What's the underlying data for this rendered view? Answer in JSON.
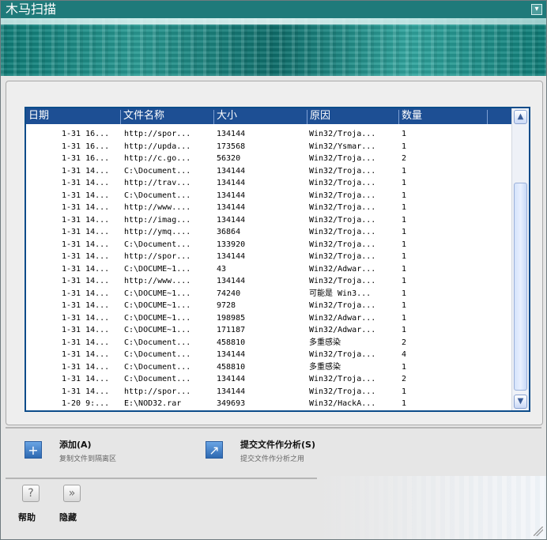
{
  "window": {
    "title": "木马扫描",
    "collapse_icon": "collapse-icon"
  },
  "table": {
    "headers": [
      "日期",
      "文件名称",
      "大小",
      "原因",
      "数量"
    ],
    "rows": [
      {
        "date": "1-31 16...",
        "name": "http://spor...",
        "size": "134144",
        "reason": "Win32/Troja...",
        "count": "1"
      },
      {
        "date": "1-31 16...",
        "name": "http://upda...",
        "size": "173568",
        "reason": "Win32/Ysmar...",
        "count": "1"
      },
      {
        "date": "1-31 16...",
        "name": "http://c.go...",
        "size": "56320",
        "reason": "Win32/Troja...",
        "count": "2"
      },
      {
        "date": "1-31 14...",
        "name": "C:\\Document...",
        "size": "134144",
        "reason": "Win32/Troja...",
        "count": "1"
      },
      {
        "date": "1-31 14...",
        "name": "http://trav...",
        "size": "134144",
        "reason": "Win32/Troja...",
        "count": "1"
      },
      {
        "date": "1-31 14...",
        "name": "C:\\Document...",
        "size": "134144",
        "reason": "Win32/Troja...",
        "count": "1"
      },
      {
        "date": "1-31 14...",
        "name": "http://www....",
        "size": "134144",
        "reason": "Win32/Troja...",
        "count": "1"
      },
      {
        "date": "1-31 14...",
        "name": "http://imag...",
        "size": "134144",
        "reason": "Win32/Troja...",
        "count": "1"
      },
      {
        "date": "1-31 14...",
        "name": "http://ymq....",
        "size": "36864",
        "reason": "Win32/Troja...",
        "count": "1"
      },
      {
        "date": "1-31 14...",
        "name": "C:\\Document...",
        "size": "133920",
        "reason": "Win32/Troja...",
        "count": "1"
      },
      {
        "date": "1-31 14...",
        "name": "http://spor...",
        "size": "134144",
        "reason": "Win32/Troja...",
        "count": "1"
      },
      {
        "date": "1-31 14...",
        "name": "C:\\DOCUME~1...",
        "size": "43",
        "reason": "Win32/Adwar...",
        "count": "1"
      },
      {
        "date": "1-31 14...",
        "name": "http://www....",
        "size": "134144",
        "reason": "Win32/Troja...",
        "count": "1"
      },
      {
        "date": "1-31 14...",
        "name": "C:\\DOCUME~1...",
        "size": "74240",
        "reason": "可能是 Win3...",
        "count": "1"
      },
      {
        "date": "1-31 14...",
        "name": "C:\\DOCUME~1...",
        "size": "9728",
        "reason": "Win32/Troja...",
        "count": "1"
      },
      {
        "date": "1-31 14...",
        "name": "C:\\DOCUME~1...",
        "size": "198985",
        "reason": "Win32/Adwar...",
        "count": "1"
      },
      {
        "date": "1-31 14...",
        "name": "C:\\DOCUME~1...",
        "size": "171187",
        "reason": "Win32/Adwar...",
        "count": "1"
      },
      {
        "date": "1-31 14...",
        "name": "C:\\Document...",
        "size": "458810",
        "reason": "多重感染",
        "count": "2"
      },
      {
        "date": "1-31 14...",
        "name": "C:\\Document...",
        "size": "134144",
        "reason": "Win32/Troja...",
        "count": "4"
      },
      {
        "date": "1-31 14...",
        "name": "C:\\Document...",
        "size": "458810",
        "reason": "多重感染",
        "count": "1"
      },
      {
        "date": "1-31 14...",
        "name": "C:\\Document...",
        "size": "134144",
        "reason": "Win32/Troja...",
        "count": "2"
      },
      {
        "date": "1-31 14...",
        "name": "http://spor...",
        "size": "134144",
        "reason": "Win32/Troja...",
        "count": "1"
      },
      {
        "date": "1-20 9:...",
        "name": "E:\\NOD32.rar",
        "size": "349693",
        "reason": "Win32/HackA...",
        "count": "1"
      }
    ]
  },
  "actions": {
    "add": {
      "label": "添加(A)",
      "description": "复制文件到隔离区",
      "icon": "plus-icon"
    },
    "submit": {
      "label": "提交文件作分析(S)",
      "description": "提交文件作分析之用",
      "icon": "external-link-icon"
    }
  },
  "bottom": {
    "help_label": "帮助",
    "hide_label": "隐藏",
    "help_icon": "help-icon",
    "hide_icon": "double-chevron-icon"
  },
  "colors": {
    "title": "#1f7a7a",
    "header": "#1d4f94",
    "action_icon": "#2d69b1"
  }
}
